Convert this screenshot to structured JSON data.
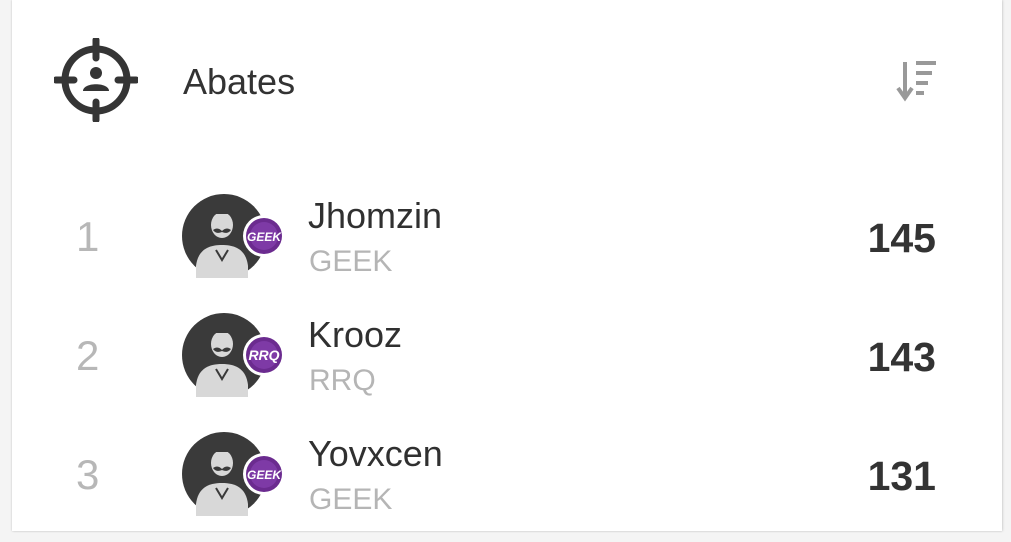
{
  "header": {
    "title": "Abates",
    "icon": "crosshair-player-icon",
    "sort_icon": "sort-descending-icon"
  },
  "leaderboard": [
    {
      "rank": "1",
      "player": "Jhomzin",
      "team": "GEEK",
      "badge": "GEEK",
      "score": "145"
    },
    {
      "rank": "2",
      "player": "Krooz",
      "team": "RRQ",
      "badge": "RRQ",
      "score": "143"
    },
    {
      "rank": "3",
      "player": "Yovxcen",
      "team": "GEEK",
      "badge": "GEEK",
      "score": "131"
    }
  ],
  "colors": {
    "text_primary": "#333333",
    "text_secondary": "#b5b5b5",
    "avatar_bg": "#3a3a3a",
    "badge_purple": "#6b2b8f"
  }
}
